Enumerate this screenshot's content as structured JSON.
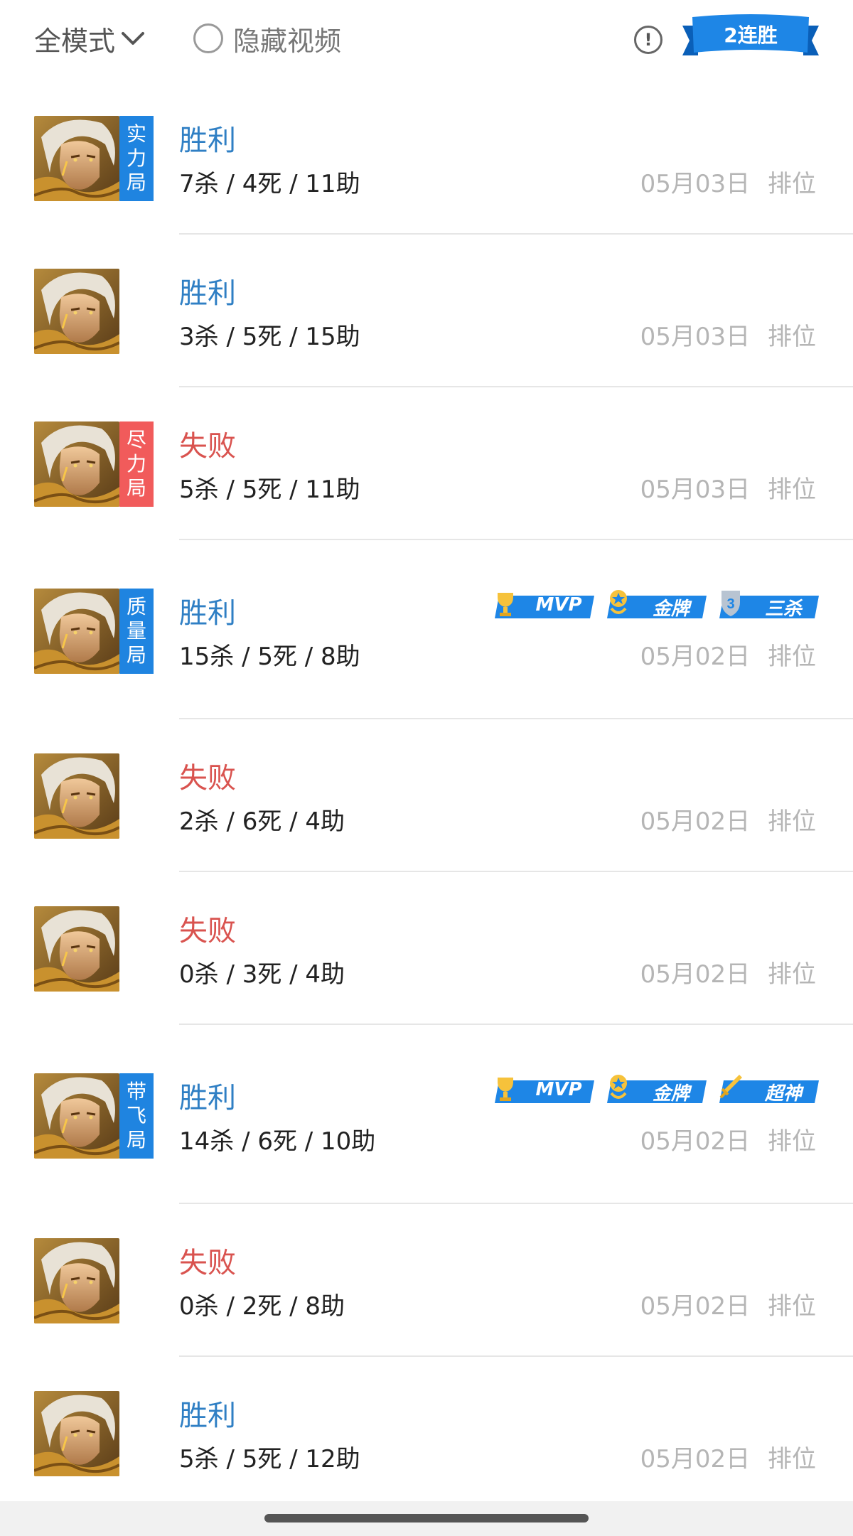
{
  "header": {
    "mode_label": "全模式",
    "hide_video_label": "隐藏视频",
    "info_symbol": "!",
    "streak_label": "2连胜"
  },
  "colors": {
    "win": "#2f7fc4",
    "loss": "#d9534f",
    "blue_tag": "#1f84e0",
    "red_tag": "#f15b5b",
    "badge_blue": "#1e86e6"
  },
  "matches": [
    {
      "result": "胜利",
      "outcome": "win",
      "kda": "7杀 / 4死 / 11助",
      "date": "05月03日",
      "mode": "排位",
      "tag": [
        "实",
        "力",
        "局"
      ],
      "tag_color": "blue",
      "badges": []
    },
    {
      "result": "胜利",
      "outcome": "win",
      "kda": "3杀 / 5死 / 15助",
      "date": "05月03日",
      "mode": "排位",
      "tag": [],
      "tag_color": "",
      "badges": []
    },
    {
      "result": "失败",
      "outcome": "loss",
      "kda": "5杀 / 5死 / 11助",
      "date": "05月03日",
      "mode": "排位",
      "tag": [
        "尽",
        "力",
        "局"
      ],
      "tag_color": "red",
      "badges": []
    },
    {
      "result": "胜利",
      "outcome": "win",
      "kda": "15杀 / 5死 / 8助",
      "date": "05月02日",
      "mode": "排位",
      "tag": [
        "质",
        "量",
        "局"
      ],
      "tag_color": "blue",
      "badges": [
        {
          "label": "MVP",
          "icon": "trophy-icon"
        },
        {
          "label": "金牌",
          "icon": "gold-medal-icon"
        },
        {
          "label": "三杀",
          "icon": "triple-kill-shield-icon"
        }
      ]
    },
    {
      "result": "失败",
      "outcome": "loss",
      "kda": "2杀 / 6死 / 4助",
      "date": "05月02日",
      "mode": "排位",
      "tag": [],
      "tag_color": "",
      "badges": []
    },
    {
      "result": "失败",
      "outcome": "loss",
      "kda": "0杀 / 3死 / 4助",
      "date": "05月02日",
      "mode": "排位",
      "tag": [],
      "tag_color": "",
      "badges": []
    },
    {
      "result": "胜利",
      "outcome": "win",
      "kda": "14杀 / 6死 / 10助",
      "date": "05月02日",
      "mode": "排位",
      "tag": [
        "带",
        "飞",
        "局"
      ],
      "tag_color": "blue",
      "badges": [
        {
          "label": "MVP",
          "icon": "trophy-icon"
        },
        {
          "label": "金牌",
          "icon": "gold-medal-icon"
        },
        {
          "label": "超神",
          "icon": "sword-icon"
        }
      ]
    },
    {
      "result": "失败",
      "outcome": "loss",
      "kda": "0杀 / 2死 / 8助",
      "date": "05月02日",
      "mode": "排位",
      "tag": [],
      "tag_color": "",
      "badges": []
    },
    {
      "result": "胜利",
      "outcome": "win",
      "kda": "5杀 / 5死 / 12助",
      "date": "05月02日",
      "mode": "排位",
      "tag": [],
      "tag_color": "",
      "badges": []
    }
  ]
}
